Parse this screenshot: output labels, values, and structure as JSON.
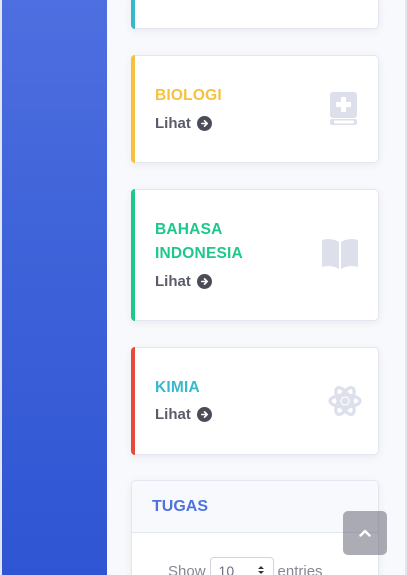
{
  "cards": [
    {
      "key": "prev",
      "title": "",
      "link_label": "",
      "accent": "#36b9cc"
    },
    {
      "key": "biologi",
      "title": "BIOLOGI",
      "link_label": "Lihat",
      "accent": "#f6c23e",
      "icon": "medical-book-icon"
    },
    {
      "key": "bahasa",
      "title_line1": "BAHASA",
      "title_line2": "INDONESIA",
      "link_label": "Lihat",
      "accent": "#1cc88a",
      "icon": "open-book-icon"
    },
    {
      "key": "kimia",
      "title": "KIMIA",
      "link_label": "Lihat",
      "accent": "#e74a3b",
      "title_color": "#36b9cc",
      "icon": "atom-icon"
    }
  ],
  "tugas": {
    "title": "TUGAS",
    "show_label": "Show",
    "entries_value": "10",
    "entries_label": "entries"
  },
  "scroll_top": {
    "icon": "chevron-up-icon"
  },
  "colors": {
    "sidebar": "#4e73df",
    "primary": "#4e73df",
    "icon_gray": "#dddfeb"
  }
}
